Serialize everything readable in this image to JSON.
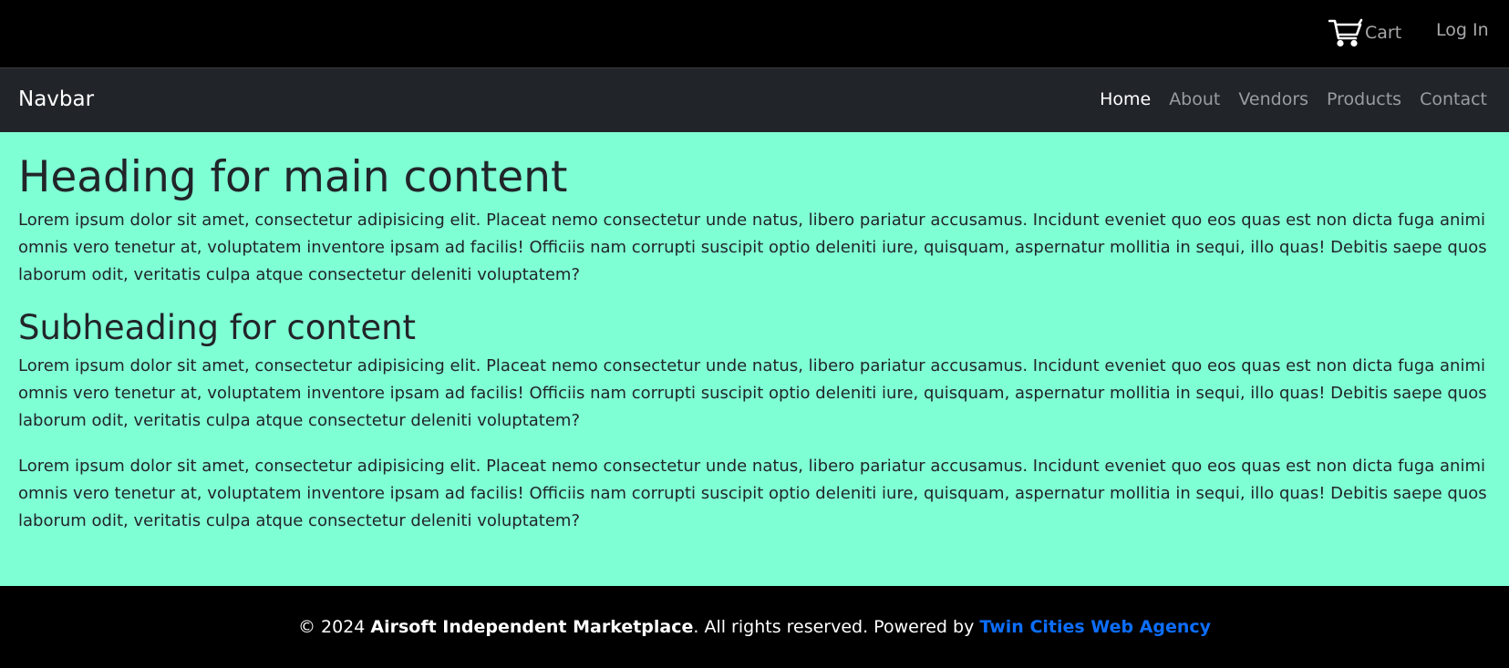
{
  "topbar": {
    "cart_label": "Cart",
    "cart_icon": "shopping-cart-icon",
    "login_label": "Log In"
  },
  "navbar": {
    "brand": "Navbar",
    "links": [
      {
        "label": "Home",
        "active": true
      },
      {
        "label": "About",
        "active": false
      },
      {
        "label": "Vendors",
        "active": false
      },
      {
        "label": "Products",
        "active": false
      },
      {
        "label": "Contact",
        "active": false
      }
    ]
  },
  "main": {
    "heading": "Heading for main content",
    "paragraph1": "Lorem ipsum dolor sit amet, consectetur adipisicing elit. Placeat nemo consectetur unde natus, libero pariatur accusamus. Incidunt eveniet quo eos quas est non dicta fuga animi omnis vero tenetur at, voluptatem inventore ipsam ad facilis! Officiis nam corrupti suscipit optio deleniti iure, quisquam, aspernatur mollitia in sequi, illo quas! Debitis saepe quos laborum odit, veritatis culpa atque consectetur deleniti voluptatem?",
    "subheading": "Subheading for content",
    "paragraph2": "Lorem ipsum dolor sit amet, consectetur adipisicing elit. Placeat nemo consectetur unde natus, libero pariatur accusamus. Incidunt eveniet quo eos quas est non dicta fuga animi omnis vero tenetur at, voluptatem inventore ipsam ad facilis! Officiis nam corrupti suscipit optio deleniti iure, quisquam, aspernatur mollitia in sequi, illo quas! Debitis saepe quos laborum odit, veritatis culpa atque consectetur deleniti voluptatem?",
    "paragraph3": "Lorem ipsum dolor sit amet, consectetur adipisicing elit. Placeat nemo consectetur unde natus, libero pariatur accusamus. Incidunt eveniet quo eos quas est non dicta fuga animi omnis vero tenetur at, voluptatem inventore ipsam ad facilis! Officiis nam corrupti suscipit optio deleniti iure, quisquam, aspernatur mollitia in sequi, illo quas! Debitis saepe quos laborum odit, veritatis culpa atque consectetur deleniti voluptatem?"
  },
  "footer": {
    "copyright": "© 2024 ",
    "company": "Airsoft Independent Marketplace",
    "rights": ". All rights reserved. Powered by ",
    "agency": "Twin Cities Web Agency"
  },
  "colors": {
    "topbar_bg": "#000000",
    "navbar_bg": "#212529",
    "main_bg": "#7fffd4",
    "footer_bg": "#000000",
    "link_accent": "#0d6efd",
    "muted_link": "#999da1"
  }
}
